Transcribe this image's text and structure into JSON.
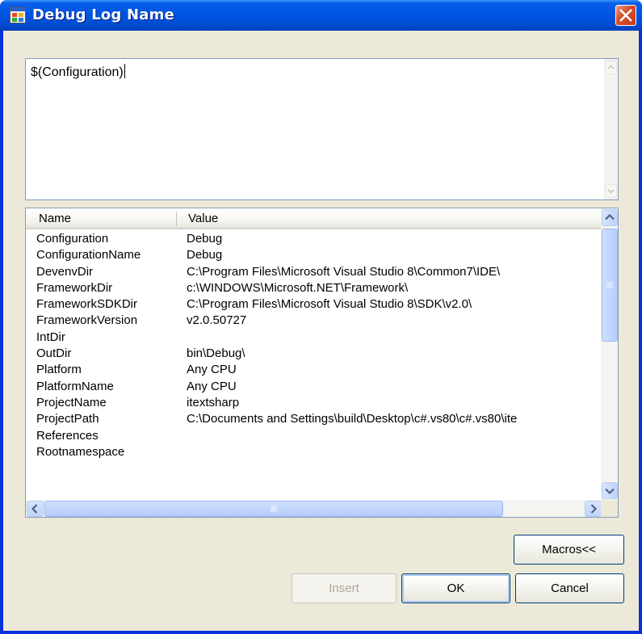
{
  "window": {
    "title": "Debug Log Name",
    "close_icon": "close-icon",
    "app_icon": "window-app-icon"
  },
  "editor": {
    "value": "$(Configuration)"
  },
  "macros_list": {
    "columns": [
      "Name",
      "Value"
    ],
    "rows": [
      {
        "name": "Configuration",
        "value": "Debug"
      },
      {
        "name": "ConfigurationName",
        "value": "Debug"
      },
      {
        "name": "DevenvDir",
        "value": "C:\\Program Files\\Microsoft Visual Studio 8\\Common7\\IDE\\"
      },
      {
        "name": "FrameworkDir",
        "value": "c:\\WINDOWS\\Microsoft.NET\\Framework\\"
      },
      {
        "name": "FrameworkSDKDir",
        "value": "C:\\Program Files\\Microsoft Visual Studio 8\\SDK\\v2.0\\"
      },
      {
        "name": "FrameworkVersion",
        "value": "v2.0.50727"
      },
      {
        "name": "IntDir",
        "value": ""
      },
      {
        "name": "OutDir",
        "value": "bin\\Debug\\"
      },
      {
        "name": "Platform",
        "value": "Any CPU"
      },
      {
        "name": "PlatformName",
        "value": "Any CPU"
      },
      {
        "name": "ProjectName",
        "value": "itextsharp"
      },
      {
        "name": "ProjectPath",
        "value": "C:\\Documents and Settings\\build\\Desktop\\c#.vs80\\c#.vs80\\ite"
      },
      {
        "name": "References",
        "value": ""
      },
      {
        "name": "Rootnamespace",
        "value": ""
      }
    ]
  },
  "buttons": {
    "macros": "Macros<<",
    "insert": "Insert",
    "ok": "OK",
    "cancel": "Cancel"
  },
  "colors": {
    "title_bar": "#0054e3",
    "dialog_bg": "#ece9d8",
    "close_button": "#c63a18"
  }
}
